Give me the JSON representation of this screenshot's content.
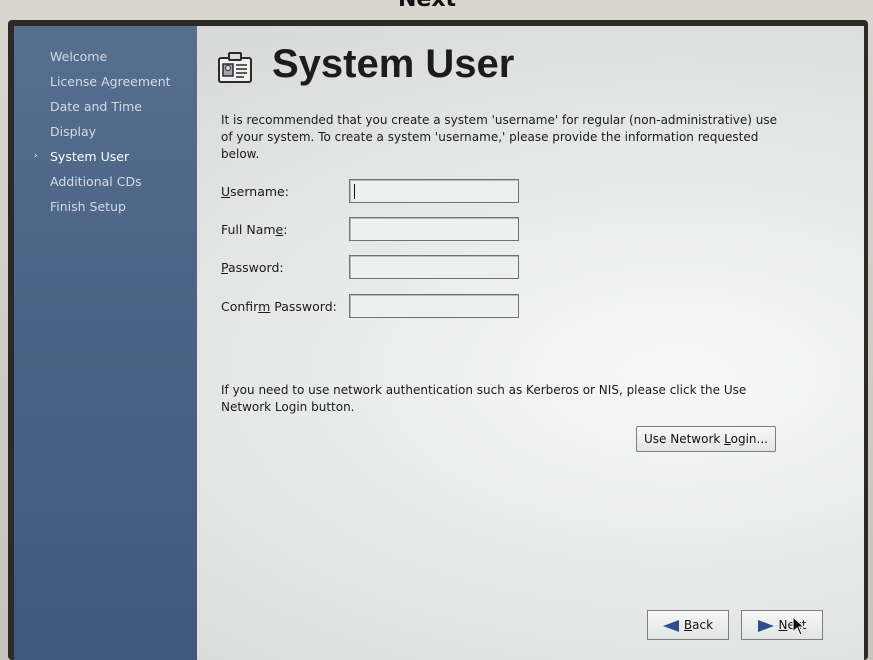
{
  "photo_caption_fragment": "Next",
  "sidebar": {
    "items": [
      {
        "label": "Welcome",
        "active": false
      },
      {
        "label": "License Agreement",
        "active": false
      },
      {
        "label": "Date and Time",
        "active": false
      },
      {
        "label": "Display",
        "active": false
      },
      {
        "label": "System User",
        "active": true
      },
      {
        "label": "Additional CDs",
        "active": false
      },
      {
        "label": "Finish Setup",
        "active": false
      }
    ],
    "active_marker": "›"
  },
  "header": {
    "title": "System User",
    "icon": "user-id-card-icon"
  },
  "intro_text": "It is recommended that you create a system 'username' for regular (non-administrative) use of your system. To create a system 'username,' please provide the information requested below.",
  "form": {
    "username": {
      "label_pre": "",
      "label_mnemonic": "U",
      "label_post": "sername:",
      "value": ""
    },
    "full_name": {
      "label_pre": "Full Nam",
      "label_mnemonic": "e",
      "label_post": ":",
      "value": ""
    },
    "password": {
      "label_pre": "",
      "label_mnemonic": "P",
      "label_post": "assword:",
      "value": ""
    },
    "confirm_password": {
      "label_pre": "Confir",
      "label_mnemonic": "m",
      "label_post": " Password:",
      "value": ""
    }
  },
  "network": {
    "text": "If you need to use network authentication such as Kerberos or NIS, please click the Use Network Login button.",
    "button_pre": "Use Network ",
    "button_mnemonic": "L",
    "button_post": "ogin..."
  },
  "nav": {
    "back_mnemonic": "B",
    "back_post": "ack",
    "next_mnemonic": "N",
    "next_post": "ext"
  },
  "colors": {
    "sidebar": "#4a6386",
    "sidebar_text": "#d5dbe4",
    "screen_bg": "#e6e8e7",
    "bezel": "#2c2a27"
  }
}
